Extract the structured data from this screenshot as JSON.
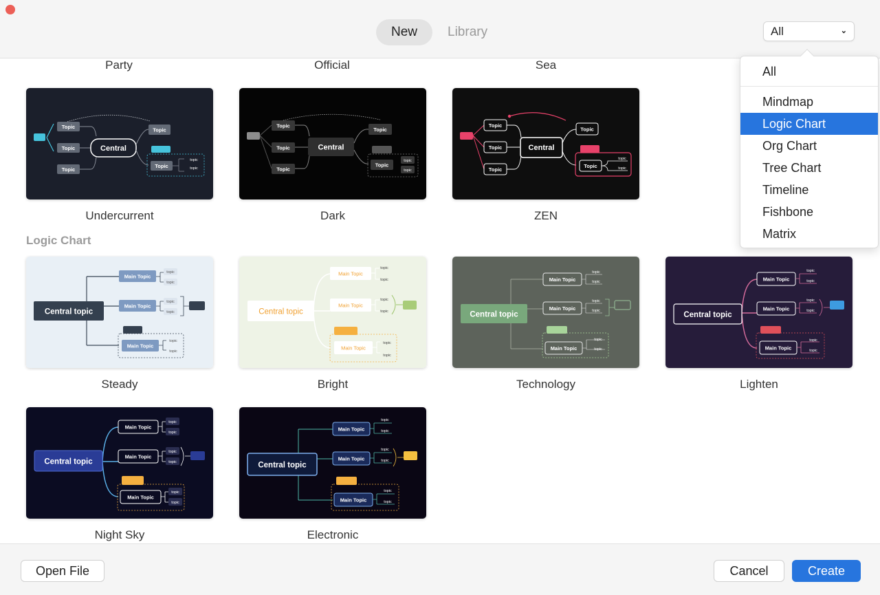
{
  "header": {
    "tabs": [
      {
        "label": "New",
        "active": true
      },
      {
        "label": "Library",
        "active": false
      }
    ],
    "filter": {
      "selected": "All"
    }
  },
  "top_row_labels": [
    "Party",
    "Official",
    "Sea"
  ],
  "themes_row": [
    {
      "name": "Undercurrent",
      "center": "Central",
      "node": "Topic",
      "sub": "topic"
    },
    {
      "name": "Dark",
      "center": "Central",
      "node": "Topic",
      "sub": "topic"
    },
    {
      "name": "ZEN",
      "center": "Central",
      "node": "Topic",
      "sub": "topic"
    }
  ],
  "logic_section": {
    "title": "Logic Chart",
    "templates": [
      {
        "name": "Steady",
        "center": "Central topic",
        "main": "Main Topic",
        "sub": "topic"
      },
      {
        "name": "Bright",
        "center": "Central topic",
        "main": "Main Topic",
        "sub": "topic"
      },
      {
        "name": "Technology",
        "center": "Central topic",
        "main": "Main Topic",
        "sub": "topic"
      },
      {
        "name": "Lighten",
        "center": "Central topic",
        "main": "Main Topic",
        "sub": "topic"
      },
      {
        "name": "Night Sky",
        "center": "Central topic",
        "main": "Main Topic",
        "sub": "topic"
      },
      {
        "name": "Electronic",
        "center": "Central topic",
        "main": "Main Topic",
        "sub": "topic"
      }
    ]
  },
  "dropdown": {
    "items": [
      "All",
      "Mindmap",
      "Logic Chart",
      "Org Chart",
      "Tree Chart",
      "Timeline",
      "Fishbone",
      "Matrix"
    ],
    "selected": "Logic Chart"
  },
  "footer": {
    "open_file": "Open File",
    "cancel": "Cancel",
    "create": "Create"
  },
  "colors": {
    "accent": "#2775de",
    "close": "#ec5f57",
    "undercurrent_bg": "#1b1f2b",
    "dark_bg": "#050505",
    "zen_bg": "#0e0e0e",
    "steady_bg": "#e9f0f6",
    "bright_bg": "#eef3e6",
    "technology_bg": "#5d635b",
    "lighten_bg": "#261c3a",
    "nightsky_bg": "#0b0c22",
    "electronic_bg": "#0a0614"
  }
}
